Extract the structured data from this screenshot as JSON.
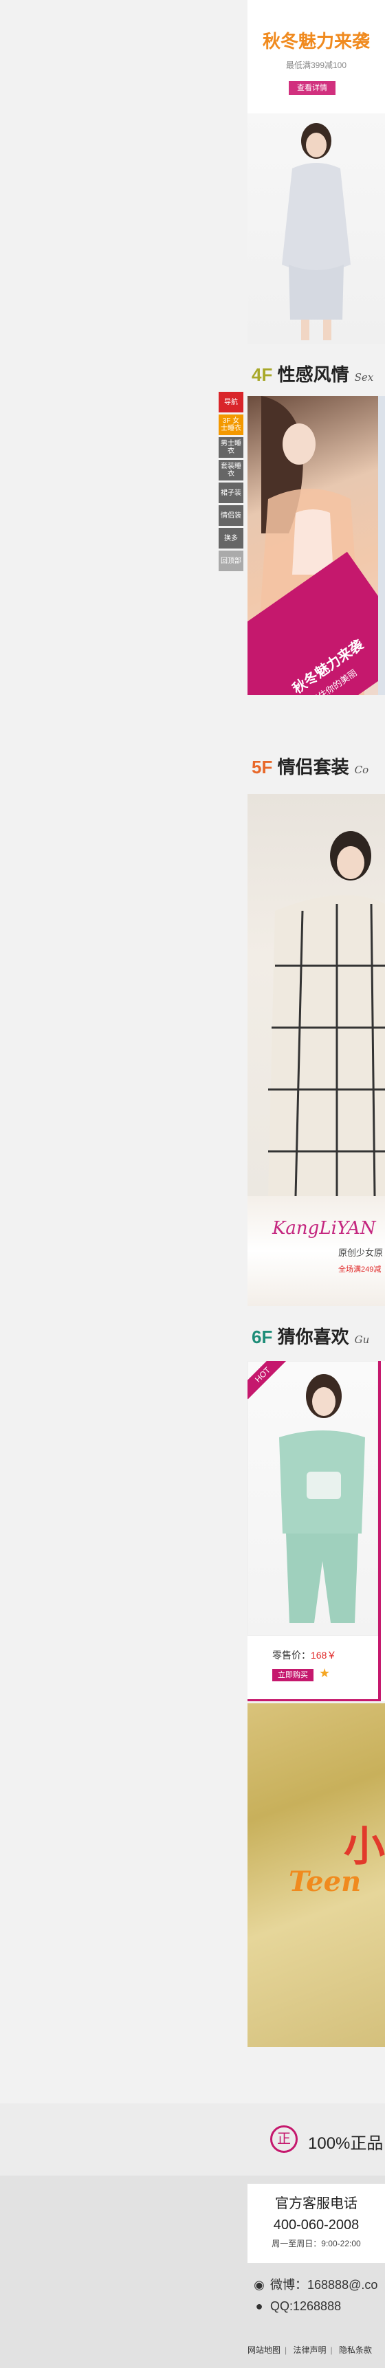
{
  "floor3": {
    "title": "秋冬魅力来袭",
    "subtitle": "最低满399减100",
    "button": "查看详情"
  },
  "sidenav": {
    "items": [
      "导航",
      "3F 女士睡衣",
      "男士睡衣",
      "套装睡衣",
      "裙子装",
      "情侣装",
      "换多",
      "回顶部"
    ]
  },
  "floor4": {
    "num": "4F",
    "title": "性感风情",
    "en": "Sex",
    "banner_title": "秋冬魅力来袭",
    "banner_sub": "留住你的美丽"
  },
  "floor5": {
    "num": "5F",
    "title": "情侣套装",
    "en": "Co",
    "brand": "KangLiYAN",
    "brand_sub": "原创少女原",
    "brand_promo": "全场满249减"
  },
  "floor6": {
    "num": "6F",
    "title": "猜你喜欢",
    "en": "Gu",
    "hot": "HOT",
    "price_label": "零售价：",
    "price_value": "168￥",
    "buy": "立即购买"
  },
  "promo": {
    "t1": "小",
    "t2": "Teen"
  },
  "service": {
    "icon": "正",
    "text": "100%正品"
  },
  "footer": {
    "hotline_title": "官方客服电话",
    "hotline_number": "400-060-2008",
    "hotline_hours": "周一至周日：9:00-22:00",
    "weibo": "微博：168888@.co",
    "qq": "QQ:1268888",
    "links": [
      "网站地图",
      "法律声明",
      "隐私条款"
    ]
  },
  "colors": {
    "accent": "#c5186d",
    "floor3_title": "#f08a1e",
    "f4_num": "#a8a829",
    "f5_num": "#e8682a",
    "f6_num": "#1e8d78"
  }
}
